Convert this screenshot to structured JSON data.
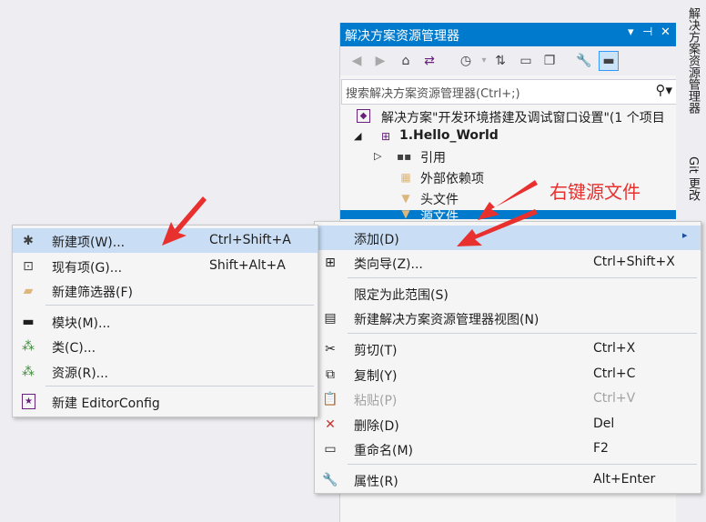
{
  "solution_explorer": {
    "title": "解决方案资源管理器",
    "title_buttons": [
      "▾",
      "⊣",
      "✕"
    ],
    "search_placeholder": "搜索解决方案资源管理器(Ctrl+;)",
    "tree": {
      "solution": "解决方案\"开发环境搭建及调试窗口设置\"(1 个项目",
      "project": "1.Hello_World",
      "references": "引用",
      "external_deps": "外部依赖项",
      "headers": "头文件",
      "sources": "源文件"
    }
  },
  "right_tabs": {
    "tab1": "解决方案资源管理器",
    "tab2": "Git 更改"
  },
  "annotation": {
    "text": "右键源文件",
    "color": "#e8312f"
  },
  "context_menu": {
    "items": [
      {
        "label": "添加(D)",
        "shortcut": "",
        "submenu": "▸"
      },
      {
        "label": "类向导(Z)...",
        "shortcut": "Ctrl+Shift+X"
      },
      {
        "label": "限定为此范围(S)",
        "shortcut": ""
      },
      {
        "label": "新建解决方案资源管理器视图(N)",
        "shortcut": ""
      },
      {
        "label": "剪切(T)",
        "shortcut": "Ctrl+X"
      },
      {
        "label": "复制(Y)",
        "shortcut": "Ctrl+C"
      },
      {
        "label": "粘贴(P)",
        "shortcut": "Ctrl+V"
      },
      {
        "label": "删除(D)",
        "shortcut": "Del"
      },
      {
        "label": "重命名(M)",
        "shortcut": "F2"
      },
      {
        "label": "属性(R)",
        "shortcut": "Alt+Enter"
      }
    ]
  },
  "submenu": {
    "items": [
      {
        "label": "新建项(W)...",
        "shortcut": "Ctrl+Shift+A"
      },
      {
        "label": "现有项(G)...",
        "shortcut": "Shift+Alt+A"
      },
      {
        "label": "新建筛选器(F)",
        "shortcut": ""
      },
      {
        "label": "模块(M)...",
        "shortcut": ""
      },
      {
        "label": "类(C)...",
        "shortcut": ""
      },
      {
        "label": "资源(R)...",
        "shortcut": ""
      },
      {
        "label": "新建 EditorConfig",
        "shortcut": ""
      }
    ]
  },
  "colors": {
    "accent": "#007acc",
    "highlight": "#c9def5",
    "annotation": "#e8312f"
  }
}
